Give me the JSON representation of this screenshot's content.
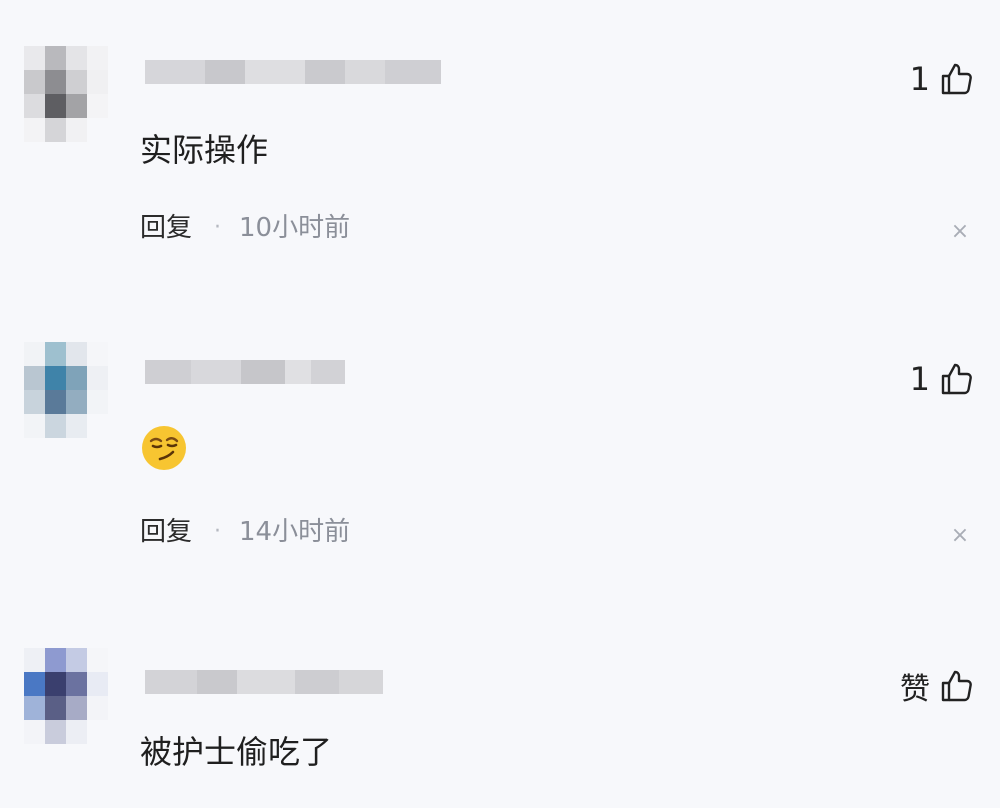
{
  "comments": [
    {
      "text": "实际操作",
      "likes": "1",
      "reply_label": "回复",
      "separator": "·",
      "time": "10小时前",
      "close_glyph": "×"
    },
    {
      "emoji_icon": "smirk-emoji",
      "likes": "1",
      "reply_label": "回复",
      "separator": "·",
      "time": "14小时前",
      "close_glyph": "×"
    },
    {
      "text": "被护士偷吃了",
      "likes": "赞"
    }
  ],
  "colors": {
    "background": "#f7f8fb",
    "time_text": "#8b8f99",
    "emoji_yellow": "#f7c531"
  }
}
